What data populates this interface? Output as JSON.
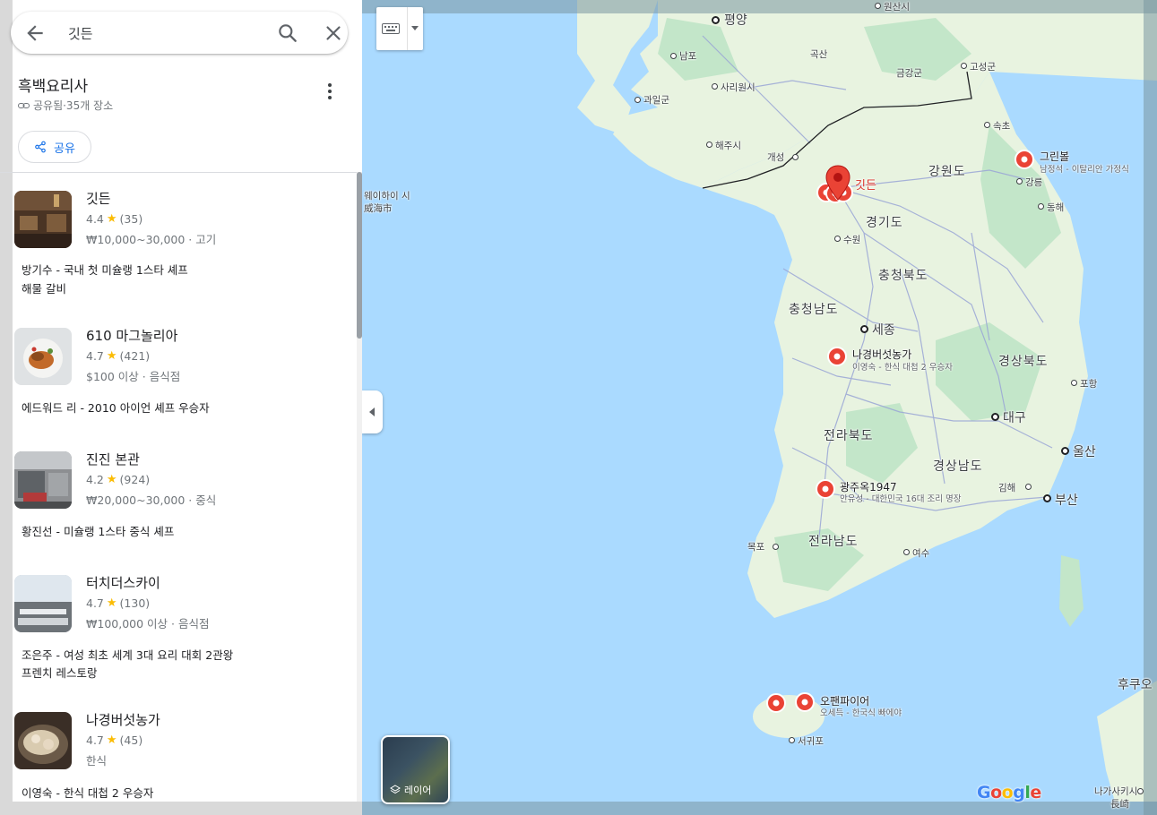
{
  "search": {
    "value": "깃든"
  },
  "list": {
    "title": "흑백요리사",
    "meta": "공유됨·35개 장소",
    "share_label": "공유"
  },
  "places": [
    {
      "name": "깃든",
      "rating": "4.4",
      "reviews": "(35)",
      "price": "₩10,000~30,000 · 고기",
      "note1": "방기수 - 국내 첫 미슐랭 1스타 셰프",
      "note2": "해물 갈비"
    },
    {
      "name": "610 마그놀리아",
      "rating": "4.7",
      "reviews": "(421)",
      "price": "$100 이상 · 음식점",
      "note1": "에드워드 리 - 2010 아이언 셰프 우승자",
      "note2": ""
    },
    {
      "name": "진진 본관",
      "rating": "4.2",
      "reviews": "(924)",
      "price": "₩20,000~30,000 · 중식",
      "note1": "황진선 - 미슐랭 1스타 중식 셰프",
      "note2": ""
    },
    {
      "name": "터치더스카이",
      "rating": "4.7",
      "reviews": "(130)",
      "price": "₩100,000 이상 · 음식점",
      "note1": "조은주 - 여성 최초 세계 3대 요리 대회 2관왕",
      "note2": "프렌치 레스토랑"
    },
    {
      "name": "나경버섯농가",
      "rating": "4.7",
      "reviews": "(45)",
      "price": "한식",
      "note1": "이영숙 - 한식 대첩 2 우승자",
      "note2": ""
    }
  ],
  "map": {
    "layer_label": "레이어",
    "google_logo": "Google",
    "cities": {
      "pyongyang": "평양",
      "wonsan": "원산시",
      "nampo": "남포",
      "goksan": "곡산",
      "sariwon": "사리원시",
      "geumgang": "금강군",
      "goseong": "고성군",
      "gwail": "과일군",
      "sokcho": "속초",
      "haeju": "해주시",
      "kaesong": "개성",
      "weihai": "웨이하이 시",
      "weihai_cn": "威海市",
      "gangneung": "강릉",
      "donghae": "동해",
      "suwon": "수원",
      "sejong": "세종",
      "pohang": "포항",
      "daegu": "대구",
      "ulsan": "울산",
      "gimhae": "김해",
      "busan": "부산",
      "mokpo": "목포",
      "yeosu": "여수",
      "seogwipo": "서귀포",
      "fukuoka": "후쿠오",
      "nagasaki": "나가사키시",
      "nagasaki_jp": "長崎"
    },
    "provinces": {
      "gangwon": "강원도",
      "gyeonggi": "경기도",
      "chungbuk": "충청북도",
      "chungnam": "충청남도",
      "gyeongbuk": "경상북도",
      "jeonbuk": "전라북도",
      "gyeongnam": "경상남도",
      "jeonnam": "전라남도"
    },
    "pins": {
      "selected": "깃든",
      "greenball": "그린볼",
      "greenball_sub": "남정석 - 이탈리안 가정식",
      "nagyeong": "나경버섯농가",
      "nagyeong_sub": "이영숙 - 한식 대첩 2 우승자",
      "gwangju": "광주옥1947",
      "gwangju_sub": "안유성 - 대한민국 16대 조리 명장",
      "openfire": "오팬파이어",
      "openfire_sub": "오세득 - 한국식 빠에야"
    },
    "colors": {
      "water": "#aadaff",
      "land": "#e8f3e0",
      "park": "#c3e6c9",
      "road": "#9aa6d6",
      "pin": "#ea4335"
    }
  }
}
